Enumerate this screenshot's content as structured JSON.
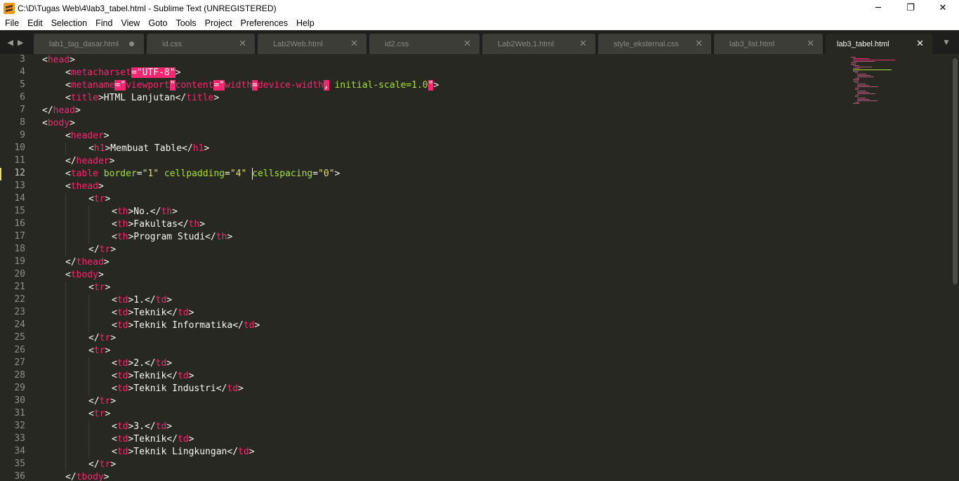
{
  "window": {
    "title": "C:\\D\\Tugas Web\\4\\lab3_tabel.html - Sublime Text (UNREGISTERED)",
    "minimize": "─",
    "restore": "❐",
    "close": "✕"
  },
  "menu": [
    "File",
    "Edit",
    "Selection",
    "Find",
    "View",
    "Goto",
    "Tools",
    "Project",
    "Preferences",
    "Help"
  ],
  "tabs": [
    {
      "label": "lab1_tag_dasar.html",
      "dirty": true,
      "active": false
    },
    {
      "label": "id.css",
      "dirty": false,
      "active": false
    },
    {
      "label": "Lab2Web.html",
      "dirty": false,
      "active": false
    },
    {
      "label": "id2.css",
      "dirty": false,
      "active": false
    },
    {
      "label": "Lab2Web.1.html",
      "dirty": false,
      "active": false
    },
    {
      "label": "style_eksternal.css",
      "dirty": false,
      "active": false
    },
    {
      "label": "lab3_list.html",
      "dirty": false,
      "active": false
    },
    {
      "label": "lab3_tabel.html",
      "dirty": false,
      "active": true
    }
  ],
  "tab_close_glyph": "✕",
  "nav_left": "◀",
  "nav_right": "▶",
  "tab_menu": "▼",
  "colors": {
    "background": "#272822",
    "tag": "#f92672",
    "attribute": "#a6e22e",
    "string": "#e6db74",
    "text": "#f8f8f2",
    "invalid_highlight": "#f92672"
  },
  "editor": {
    "current_line": 12,
    "lines": [
      {
        "n": 3,
        "ind": 0,
        "seg": [
          [
            "p",
            "<"
          ],
          [
            "t",
            "head"
          ],
          [
            "p",
            ">"
          ]
        ]
      },
      {
        "n": 4,
        "ind": 1,
        "seg": [
          [
            "p",
            "<"
          ],
          [
            "t",
            "meta"
          ],
          [
            "t",
            "charset"
          ],
          [
            "h",
            "=\"UTF-8"
          ],
          [
            "h",
            "\""
          ],
          [
            "p",
            ">"
          ]
        ]
      },
      {
        "n": 5,
        "ind": 1,
        "seg": [
          [
            "p",
            "<"
          ],
          [
            "t",
            "meta"
          ],
          [
            "t",
            "name"
          ],
          [
            "h",
            "=\""
          ],
          [
            "t",
            "viewport"
          ],
          [
            "h",
            "\""
          ],
          [
            "t",
            "content"
          ],
          [
            "h",
            "=\""
          ],
          [
            "t",
            "width"
          ],
          [
            "h",
            "="
          ],
          [
            "t",
            "device-width"
          ],
          [
            "h",
            ","
          ],
          [
            "a",
            " initial-scale=1.0"
          ],
          [
            "h",
            "\""
          ],
          [
            "p",
            ">"
          ]
        ]
      },
      {
        "n": 6,
        "ind": 1,
        "seg": [
          [
            "p",
            "<"
          ],
          [
            "t",
            "title"
          ],
          [
            "p",
            ">HTML Lanjutan</"
          ],
          [
            "t",
            "title"
          ],
          [
            "p",
            ">"
          ]
        ]
      },
      {
        "n": 7,
        "ind": 0,
        "seg": [
          [
            "p",
            "</"
          ],
          [
            "t",
            "head"
          ],
          [
            "p",
            ">"
          ]
        ]
      },
      {
        "n": 8,
        "ind": 0,
        "seg": [
          [
            "p",
            "<"
          ],
          [
            "t",
            "body"
          ],
          [
            "p",
            ">"
          ]
        ]
      },
      {
        "n": 9,
        "ind": 1,
        "seg": [
          [
            "p",
            "<"
          ],
          [
            "t",
            "header"
          ],
          [
            "p",
            ">"
          ]
        ]
      },
      {
        "n": 10,
        "ind": 2,
        "seg": [
          [
            "p",
            "<"
          ],
          [
            "t",
            "h1"
          ],
          [
            "p",
            ">Membuat Table</"
          ],
          [
            "t",
            "h1"
          ],
          [
            "p",
            ">"
          ]
        ]
      },
      {
        "n": 11,
        "ind": 1,
        "seg": [
          [
            "p",
            "</"
          ],
          [
            "t",
            "header"
          ],
          [
            "p",
            ">"
          ]
        ]
      },
      {
        "n": 12,
        "ind": 1,
        "seg": [
          [
            "p",
            "<"
          ],
          [
            "t",
            "table"
          ],
          [
            "p",
            " "
          ],
          [
            "a",
            "border"
          ],
          [
            "p",
            "="
          ],
          [
            "s",
            "\"1\""
          ],
          [
            "p",
            " "
          ],
          [
            "a",
            "cellpadding"
          ],
          [
            "p",
            "="
          ],
          [
            "s",
            "\"4\""
          ],
          [
            "p",
            " "
          ],
          [
            "a",
            "cellspacing"
          ],
          [
            "p",
            "="
          ],
          [
            "s",
            "\"0\""
          ],
          [
            "p",
            ">"
          ]
        ]
      },
      {
        "n": 13,
        "ind": 1,
        "seg": [
          [
            "p",
            "<"
          ],
          [
            "t",
            "thead"
          ],
          [
            "p",
            ">"
          ]
        ]
      },
      {
        "n": 14,
        "ind": 2,
        "seg": [
          [
            "p",
            "<"
          ],
          [
            "t",
            "tr"
          ],
          [
            "p",
            ">"
          ]
        ]
      },
      {
        "n": 15,
        "ind": 3,
        "seg": [
          [
            "p",
            "<"
          ],
          [
            "t",
            "th"
          ],
          [
            "p",
            ">No.</"
          ],
          [
            "t",
            "th"
          ],
          [
            "p",
            ">"
          ]
        ]
      },
      {
        "n": 16,
        "ind": 3,
        "seg": [
          [
            "p",
            "<"
          ],
          [
            "t",
            "th"
          ],
          [
            "p",
            ">Fakultas</"
          ],
          [
            "t",
            "th"
          ],
          [
            "p",
            ">"
          ]
        ]
      },
      {
        "n": 17,
        "ind": 3,
        "seg": [
          [
            "p",
            "<"
          ],
          [
            "t",
            "th"
          ],
          [
            "p",
            ">Program Studi</"
          ],
          [
            "t",
            "th"
          ],
          [
            "p",
            ">"
          ]
        ]
      },
      {
        "n": 18,
        "ind": 2,
        "seg": [
          [
            "p",
            "</"
          ],
          [
            "t",
            "tr"
          ],
          [
            "p",
            ">"
          ]
        ]
      },
      {
        "n": 19,
        "ind": 1,
        "seg": [
          [
            "p",
            "</"
          ],
          [
            "t",
            "thead"
          ],
          [
            "p",
            ">"
          ]
        ]
      },
      {
        "n": 20,
        "ind": 1,
        "seg": [
          [
            "p",
            "<"
          ],
          [
            "t",
            "tbody"
          ],
          [
            "p",
            ">"
          ]
        ]
      },
      {
        "n": 21,
        "ind": 2,
        "seg": [
          [
            "p",
            "<"
          ],
          [
            "t",
            "tr"
          ],
          [
            "p",
            ">"
          ]
        ]
      },
      {
        "n": 22,
        "ind": 3,
        "seg": [
          [
            "p",
            "<"
          ],
          [
            "t",
            "td"
          ],
          [
            "p",
            ">1.</"
          ],
          [
            "t",
            "td"
          ],
          [
            "p",
            ">"
          ]
        ]
      },
      {
        "n": 23,
        "ind": 3,
        "seg": [
          [
            "p",
            "<"
          ],
          [
            "t",
            "td"
          ],
          [
            "p",
            ">Teknik</"
          ],
          [
            "t",
            "td"
          ],
          [
            "p",
            ">"
          ]
        ]
      },
      {
        "n": 24,
        "ind": 3,
        "seg": [
          [
            "p",
            "<"
          ],
          [
            "t",
            "td"
          ],
          [
            "p",
            ">Teknik Informatika</"
          ],
          [
            "t",
            "td"
          ],
          [
            "p",
            ">"
          ]
        ]
      },
      {
        "n": 25,
        "ind": 2,
        "seg": [
          [
            "p",
            "</"
          ],
          [
            "t",
            "tr"
          ],
          [
            "p",
            ">"
          ]
        ]
      },
      {
        "n": 26,
        "ind": 2,
        "seg": [
          [
            "p",
            "<"
          ],
          [
            "t",
            "tr"
          ],
          [
            "p",
            ">"
          ]
        ]
      },
      {
        "n": 27,
        "ind": 3,
        "seg": [
          [
            "p",
            "<"
          ],
          [
            "t",
            "td"
          ],
          [
            "p",
            ">2.</"
          ],
          [
            "t",
            "td"
          ],
          [
            "p",
            ">"
          ]
        ]
      },
      {
        "n": 28,
        "ind": 3,
        "seg": [
          [
            "p",
            "<"
          ],
          [
            "t",
            "td"
          ],
          [
            "p",
            ">Teknik</"
          ],
          [
            "t",
            "td"
          ],
          [
            "p",
            ">"
          ]
        ]
      },
      {
        "n": 29,
        "ind": 3,
        "seg": [
          [
            "p",
            "<"
          ],
          [
            "t",
            "td"
          ],
          [
            "p",
            ">Teknik Industri</"
          ],
          [
            "t",
            "td"
          ],
          [
            "p",
            ">"
          ]
        ]
      },
      {
        "n": 30,
        "ind": 2,
        "seg": [
          [
            "p",
            "</"
          ],
          [
            "t",
            "tr"
          ],
          [
            "p",
            ">"
          ]
        ]
      },
      {
        "n": 31,
        "ind": 2,
        "seg": [
          [
            "p",
            "<"
          ],
          [
            "t",
            "tr"
          ],
          [
            "p",
            ">"
          ]
        ]
      },
      {
        "n": 32,
        "ind": 3,
        "seg": [
          [
            "p",
            "<"
          ],
          [
            "t",
            "td"
          ],
          [
            "p",
            ">3.</"
          ],
          [
            "t",
            "td"
          ],
          [
            "p",
            ">"
          ]
        ]
      },
      {
        "n": 33,
        "ind": 3,
        "seg": [
          [
            "p",
            "<"
          ],
          [
            "t",
            "td"
          ],
          [
            "p",
            ">Teknik</"
          ],
          [
            "t",
            "td"
          ],
          [
            "p",
            ">"
          ]
        ]
      },
      {
        "n": 34,
        "ind": 3,
        "seg": [
          [
            "p",
            "<"
          ],
          [
            "t",
            "td"
          ],
          [
            "p",
            ">Teknik Lingkungan</"
          ],
          [
            "t",
            "td"
          ],
          [
            "p",
            ">"
          ]
        ]
      },
      {
        "n": 35,
        "ind": 2,
        "seg": [
          [
            "p",
            "</"
          ],
          [
            "t",
            "tr"
          ],
          [
            "p",
            ">"
          ]
        ]
      },
      {
        "n": 36,
        "ind": 1,
        "seg": [
          [
            "p",
            "</"
          ],
          [
            "t",
            "tbody"
          ],
          [
            "p",
            ">"
          ]
        ]
      }
    ]
  }
}
